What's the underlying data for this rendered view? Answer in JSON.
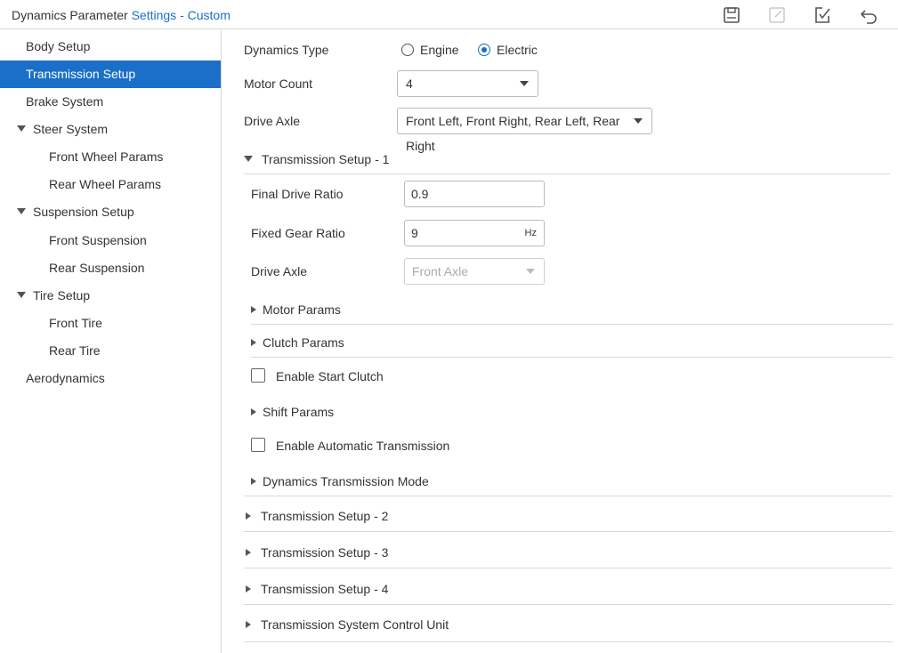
{
  "header": {
    "title_prefix": "Dynamics Parameter",
    "title_suffix": "Settings - Custom",
    "icons": [
      "save-icon",
      "edit-icon",
      "check-edit-icon",
      "undo-icon"
    ]
  },
  "sidebar": {
    "items": [
      {
        "label": "Body Setup"
      },
      {
        "label": "Transmission Setup",
        "active": true
      },
      {
        "label": "Brake System"
      },
      {
        "label": "Steer System",
        "expanded": true
      },
      {
        "label": "Front Wheel Params"
      },
      {
        "label": "Rear Wheel Params"
      },
      {
        "label": "Suspension Setup",
        "expanded": true
      },
      {
        "label": "Front Suspension"
      },
      {
        "label": "Rear Suspension"
      },
      {
        "label": "Tire Setup",
        "expanded": true
      },
      {
        "label": "Front Tire"
      },
      {
        "label": "Rear Tire"
      },
      {
        "label": "Aerodynamics"
      }
    ]
  },
  "main": {
    "dynamics_type": {
      "label": "Dynamics Type",
      "options": [
        "Engine",
        "Electric"
      ],
      "selected": "Electric"
    },
    "motor_count": {
      "label": "Motor Count",
      "value": "4"
    },
    "drive_axle": {
      "label": "Drive Axle",
      "value": "Front Left, Front Right, Rear Left, Rear Right"
    },
    "setup1": {
      "title": "Transmission Setup - 1",
      "final_drive_ratio": {
        "label": "Final Drive Ratio",
        "value": "0.9"
      },
      "fixed_gear_ratio": {
        "label": "Fixed Gear Ratio",
        "value": "9",
        "unit": "Hz"
      },
      "drive_axle": {
        "label": "Drive Axle",
        "value": "Front Axle"
      },
      "motor_params": "Motor Params",
      "clutch_params": "Clutch Params",
      "enable_start_clutch": "Enable Start Clutch",
      "shift_params": "Shift Params",
      "enable_auto_transmission": "Enable Automatic Transmission",
      "dynamics_transmission_mode": "Dynamics Transmission Mode"
    },
    "sections": [
      "Transmission Setup - 2",
      "Transmission Setup - 3",
      "Transmission Setup - 4",
      "Transmission System Control Unit"
    ]
  },
  "colors": {
    "accent": "#1a6fc9",
    "border": "#d9d9d9"
  }
}
